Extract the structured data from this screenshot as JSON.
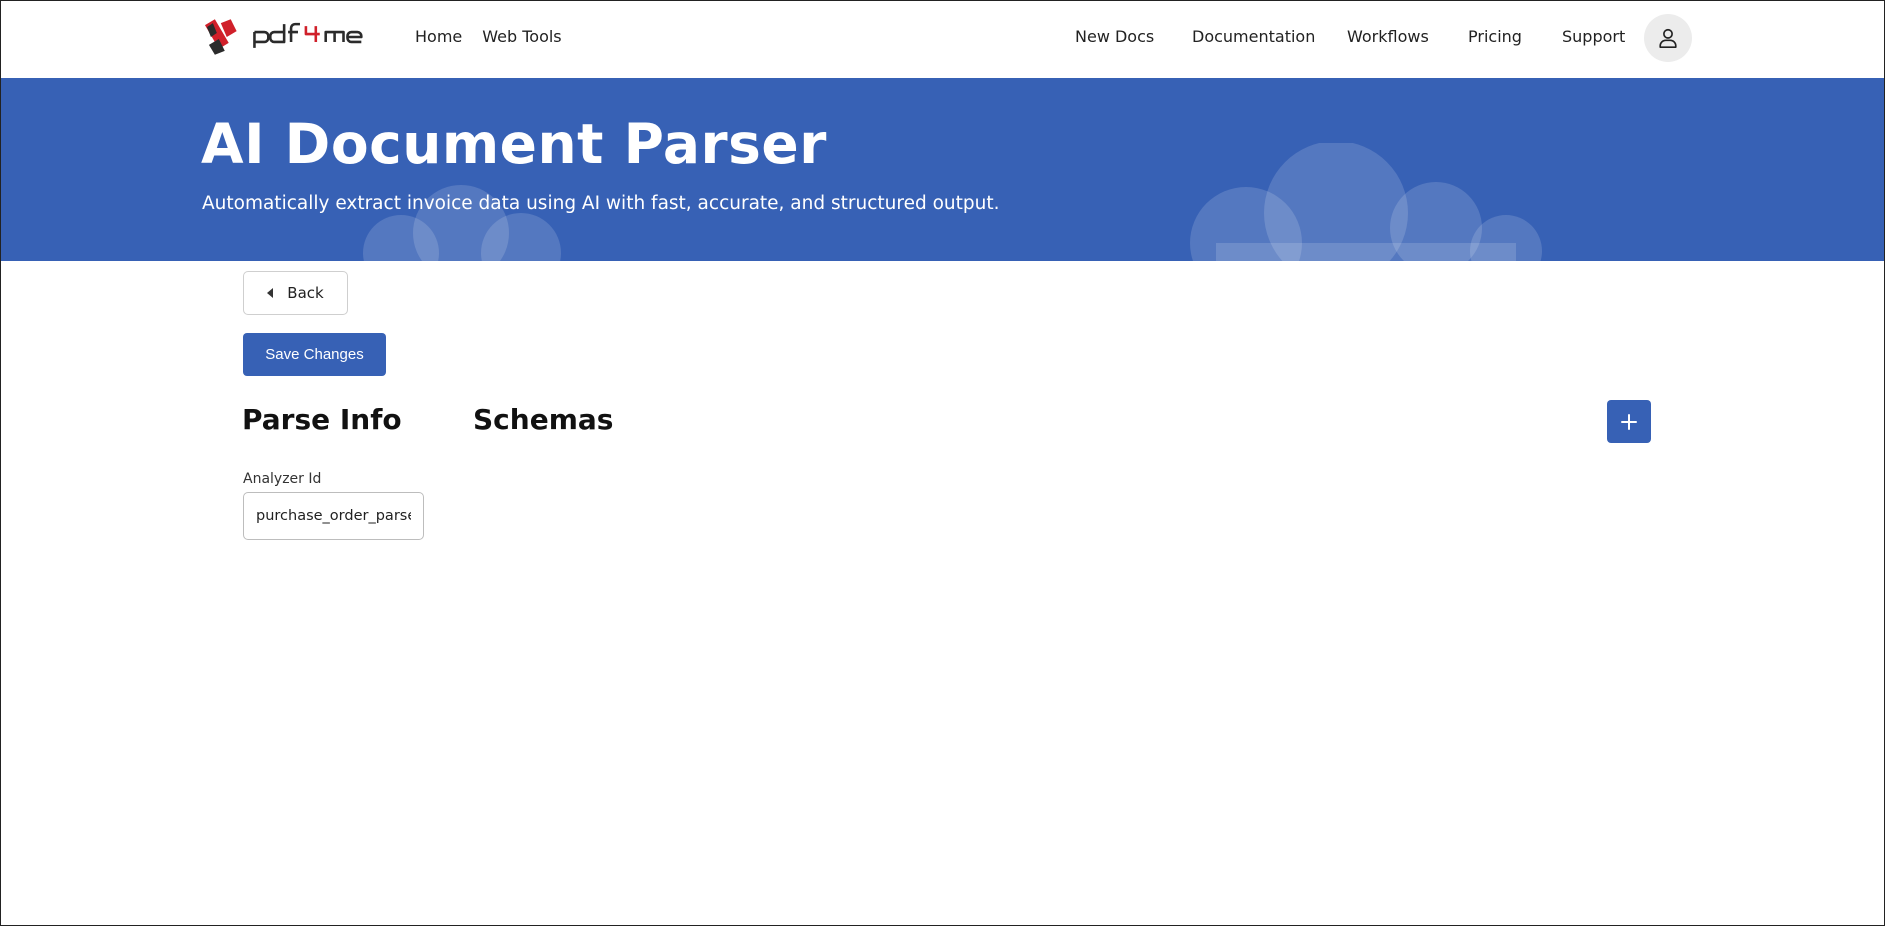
{
  "header": {
    "logo_text": "pdf4me",
    "nav_left": [
      {
        "label": "Home"
      },
      {
        "label": "Web Tools"
      }
    ],
    "nav_right": [
      {
        "label": "New Docs"
      },
      {
        "label": "Documentation"
      },
      {
        "label": "Workflows"
      },
      {
        "label": "Pricing"
      },
      {
        "label": "Support"
      }
    ],
    "account_icon": "user-icon"
  },
  "hero": {
    "title": "AI Document Parser",
    "subtitle": "Automatically extract invoice data using AI with fast, accurate, and structured output."
  },
  "actions": {
    "back_label": "Back",
    "save_label": "Save Changes",
    "add_icon": "plus-icon"
  },
  "sections": {
    "parse_info_title": "Parse Info",
    "schemas_title": "Schemas"
  },
  "form": {
    "analyzer_id_label": "Analyzer Id",
    "analyzer_id_value": "purchase_order_parser"
  },
  "colors": {
    "brand_blue": "#3761b5",
    "logo_red": "#d0202a",
    "logo_dark": "#2b2b2b"
  }
}
